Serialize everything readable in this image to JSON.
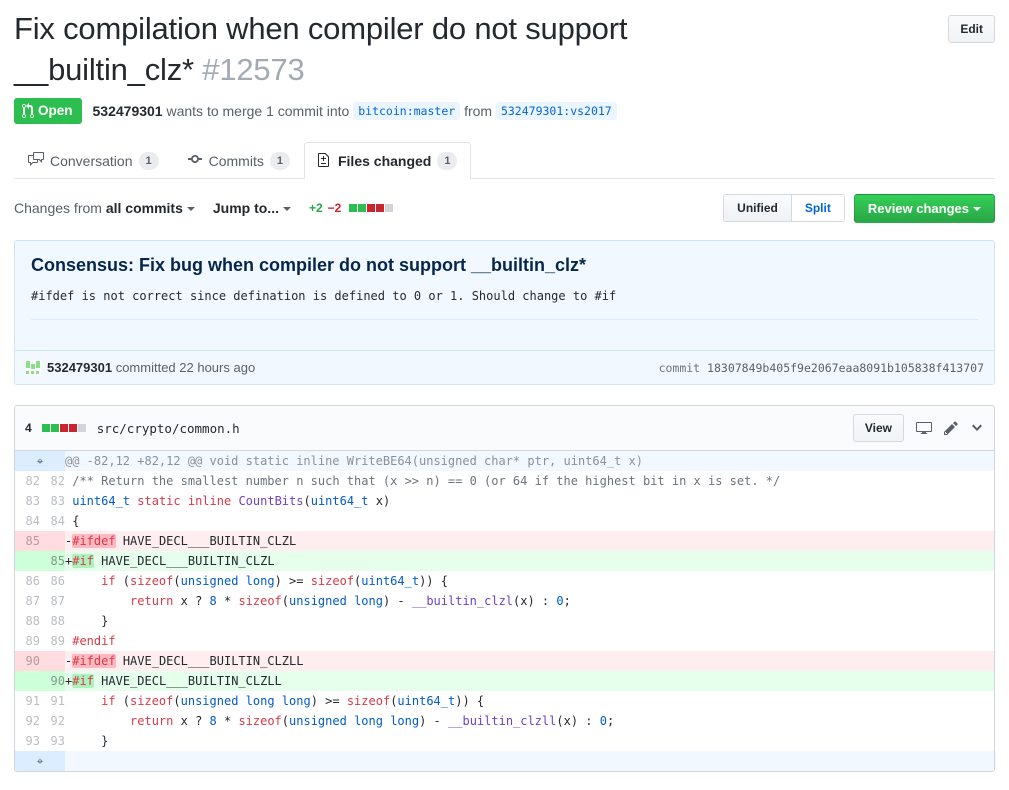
{
  "header": {
    "title": "Fix compilation when compiler do not support __builtin_clz*",
    "number": "#12573",
    "edit_label": "Edit",
    "state": "Open",
    "author": "532479301",
    "merge_text_1": "wants to merge 1 commit into",
    "base_branch": "bitcoin:master",
    "merge_text_2": "from",
    "head_branch": "532479301:vs2017"
  },
  "tabs": [
    {
      "label": "Conversation",
      "count": "1",
      "icon": "comment-discussion-icon",
      "selected": false
    },
    {
      "label": "Commits",
      "count": "1",
      "icon": "git-commit-icon",
      "selected": false
    },
    {
      "label": "Files changed",
      "count": "1",
      "icon": "diff-icon",
      "selected": true
    }
  ],
  "subnav": {
    "changes_from_prefix": "Changes from ",
    "changes_from_value": "all commits",
    "jump_to": "Jump to...",
    "added": "+2",
    "deleted": "−2",
    "blocks": [
      "g",
      "g",
      "r",
      "r",
      "n"
    ],
    "unified_label": "Unified",
    "split_label": "Split",
    "review_changes_label": "Review changes"
  },
  "commit": {
    "title": "Consensus: Fix bug when compiler do not support __builtin_clz*",
    "description": "#ifdef is not correct since defination is defined to 0 or 1. Should change to #if",
    "author": "532479301",
    "committed_text": "committed 22 hours ago",
    "sha_label": "commit",
    "sha": "18307849b405f9e2067eaa8091b105838f413707"
  },
  "file": {
    "change_count": "4",
    "blocks": [
      "g",
      "g",
      "r",
      "r",
      "n"
    ],
    "path": "src/crypto/common.h",
    "view_label": "View",
    "icons": [
      "display-icon",
      "pencil-icon",
      "chevron-down-icon"
    ]
  },
  "diff": {
    "rows": [
      {
        "type": "hunk",
        "old": "",
        "new": "",
        "code": "@@ -82,12 +82,12 @@ void static inline WriteBE64(unsigned char* ptr, uint64_t x)"
      },
      {
        "type": "ctx",
        "old": "82",
        "new": "82",
        "code": " /** Return the smallest number n such that (x >> n) == 0 (or 64 if the highest bit in x is set. */"
      },
      {
        "type": "ctx",
        "old": "83",
        "new": "83",
        "code": " uint64_t static inline CountBits(uint64_t x)"
      },
      {
        "type": "ctx",
        "old": "84",
        "new": "84",
        "code": " {"
      },
      {
        "type": "del",
        "old": "85",
        "new": "",
        "code": "-#ifdef HAVE_DECL___BUILTIN_CLZL"
      },
      {
        "type": "add",
        "old": "",
        "new": "85",
        "code": "+#if HAVE_DECL___BUILTIN_CLZL"
      },
      {
        "type": "ctx",
        "old": "86",
        "new": "86",
        "code": "     if (sizeof(unsigned long) >= sizeof(uint64_t)) {"
      },
      {
        "type": "ctx",
        "old": "87",
        "new": "87",
        "code": "         return x ? 8 * sizeof(unsigned long) - __builtin_clzl(x) : 0;"
      },
      {
        "type": "ctx",
        "old": "88",
        "new": "88",
        "code": "     }"
      },
      {
        "type": "ctx",
        "old": "89",
        "new": "89",
        "code": " #endif"
      },
      {
        "type": "del",
        "old": "90",
        "new": "",
        "code": "-#ifdef HAVE_DECL___BUILTIN_CLZLL"
      },
      {
        "type": "add",
        "old": "",
        "new": "90",
        "code": "+#if HAVE_DECL___BUILTIN_CLZLL"
      },
      {
        "type": "ctx",
        "old": "91",
        "new": "91",
        "code": "     if (sizeof(unsigned long long) >= sizeof(uint64_t)) {"
      },
      {
        "type": "ctx",
        "old": "92",
        "new": "92",
        "code": "         return x ? 8 * sizeof(unsigned long long) - __builtin_clzll(x) : 0;"
      },
      {
        "type": "ctx",
        "old": "93",
        "new": "93",
        "code": "     }"
      },
      {
        "type": "hunk-end",
        "old": "",
        "new": "",
        "code": ""
      }
    ]
  }
}
